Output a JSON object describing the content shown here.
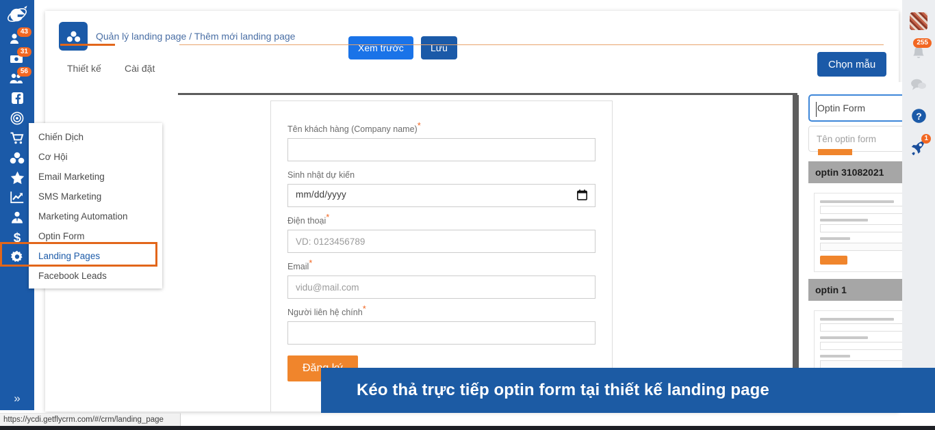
{
  "app": {
    "logo_icon": "getfly-logo-icon",
    "status_url": "https://ycdi.getflycrm.com/#/crm/landing_page"
  },
  "left_rail": {
    "items": [
      {
        "icon": "customer-icon",
        "badge": "43"
      },
      {
        "icon": "invoice-icon",
        "badge": "31"
      },
      {
        "icon": "contacts-icon",
        "badge": "56"
      },
      {
        "icon": "facebook-icon",
        "badge": ""
      },
      {
        "icon": "target-icon",
        "badge": ""
      },
      {
        "icon": "cart-icon",
        "badge": ""
      },
      {
        "icon": "cubes-icon",
        "badge": ""
      },
      {
        "icon": "star-icon",
        "badge": ""
      },
      {
        "icon": "chart-line-icon",
        "badge": ""
      },
      {
        "icon": "user-tie-icon",
        "badge": ""
      },
      {
        "icon": "dollar-icon",
        "badge": ""
      },
      {
        "icon": "gear-icon",
        "badge": ""
      }
    ],
    "expand_icon": "chevron-double-right-icon"
  },
  "flyout_menu": {
    "items": [
      {
        "label": "Chiến Dịch",
        "active": false
      },
      {
        "label": "Cơ Hội",
        "active": false
      },
      {
        "label": "Email Marketing",
        "active": false
      },
      {
        "label": "SMS Marketing",
        "active": false
      },
      {
        "label": "Marketing Automation",
        "active": false
      },
      {
        "label": "Optin Form",
        "active": false
      },
      {
        "label": "Landing Pages",
        "active": true
      },
      {
        "label": "Facebook Leads",
        "active": false
      }
    ],
    "highlight_color": "#e2661a"
  },
  "header": {
    "icon": "cubes-icon",
    "breadcrumb": "Quản lý landing page / Thêm mới landing page",
    "preview_label": "Xem trước",
    "save_label": "Lưu",
    "choose_template_label": "Chọn mẫu"
  },
  "tabs": {
    "items": [
      {
        "label": "Thiết kế",
        "active": true
      },
      {
        "label": "Cài đặt",
        "active": false
      }
    ],
    "accent_color": "#e2661a"
  },
  "optin_form": {
    "fields": [
      {
        "label": "Tên khách hàng (Company name)",
        "required": true,
        "type": "text",
        "value": "",
        "placeholder": ""
      },
      {
        "label": "Sinh nhật dự kiến",
        "required": false,
        "type": "date",
        "value": "",
        "placeholder": "mm/dd/yyyy"
      },
      {
        "label": "Điện thoại",
        "required": true,
        "type": "tel",
        "value": "",
        "placeholder": "VD: 0123456789"
      },
      {
        "label": "Email",
        "required": true,
        "type": "email",
        "value": "",
        "placeholder": "vidu@mail.com"
      },
      {
        "label": "Người liên hệ chính",
        "required": true,
        "type": "text",
        "value": "",
        "placeholder": ""
      }
    ],
    "submit_label": "Đăng ký",
    "submit_color": "#f0852c",
    "required_marker": "*"
  },
  "right_panel": {
    "select": {
      "value": "Optin Form",
      "caret_icon": "chevron-down-icon"
    },
    "name_input": {
      "value": "",
      "placeholder": "Tên optin form"
    },
    "templates": [
      {
        "title": "optin 31082021"
      },
      {
        "title": "optin 1"
      }
    ]
  },
  "right_rail": {
    "items": [
      {
        "icon": "avatar",
        "badge": ""
      },
      {
        "icon": "bell-icon",
        "badge": "255"
      },
      {
        "icon": "chat-bubble-icon",
        "badge": ""
      },
      {
        "icon": "help-circle-icon",
        "badge": ""
      },
      {
        "icon": "rocket-icon",
        "badge": "1"
      }
    ]
  },
  "banner": {
    "text": "Kéo thả trực tiếp optin form tại thiết kế landing page",
    "background": "#1c5ba4"
  }
}
